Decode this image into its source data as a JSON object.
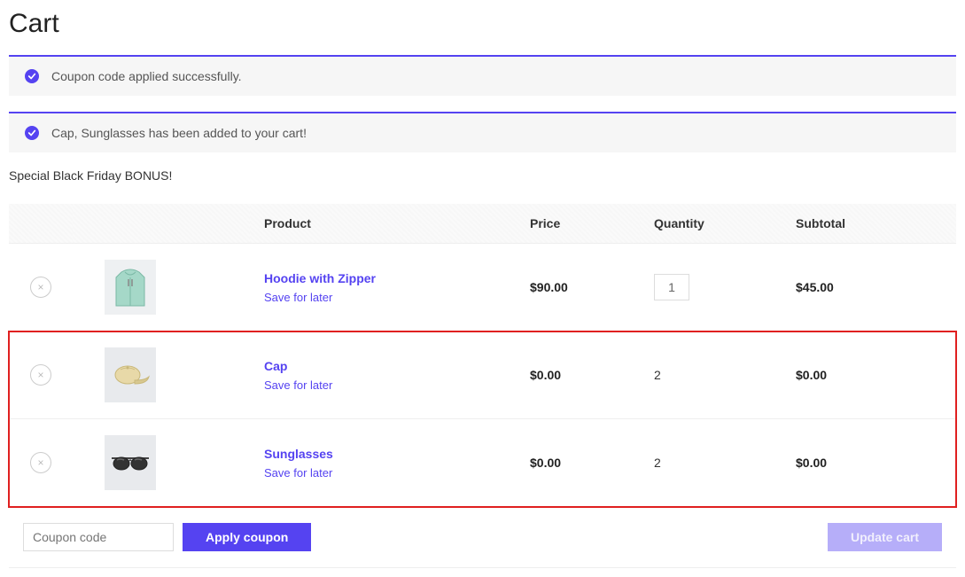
{
  "page": {
    "title": "Cart"
  },
  "notices": {
    "coupon_applied": "Coupon code applied successfully.",
    "added_to_cart": "Cap, Sunglasses has been added to your cart!"
  },
  "bonus_label": "Special Black Friday BONUS!",
  "table": {
    "headers": {
      "product": "Product",
      "price": "Price",
      "quantity": "Quantity",
      "subtotal": "Subtotal"
    },
    "rows": [
      {
        "name": "Hoodie with Zipper",
        "save_label": "Save for later",
        "price": "$90.00",
        "qty": "1",
        "qty_editable": true,
        "subtotal": "$45.00",
        "thumb": "hoodie"
      },
      {
        "name": "Cap",
        "save_label": "Save for later",
        "price": "$0.00",
        "qty": "2",
        "qty_editable": false,
        "subtotal": "$0.00",
        "thumb": "cap"
      },
      {
        "name": "Sunglasses",
        "save_label": "Save for later",
        "price": "$0.00",
        "qty": "2",
        "qty_editable": false,
        "subtotal": "$0.00",
        "thumb": "sunglasses"
      }
    ]
  },
  "actions": {
    "coupon_placeholder": "Coupon code",
    "apply_coupon": "Apply coupon",
    "update_cart": "Update cart"
  },
  "colors": {
    "accent": "#5543f1",
    "highlight": "#e02020"
  },
  "icons": {
    "remove": "×"
  }
}
